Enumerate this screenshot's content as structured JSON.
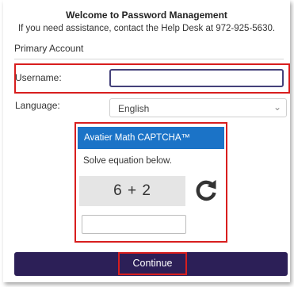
{
  "header": {
    "title": "Welcome to Password Management",
    "subtitle": "If you need assistance, contact the Help Desk at 972-925-5630."
  },
  "section": {
    "label": "Primary Account"
  },
  "form": {
    "username_label": "Username:",
    "username_value": "",
    "language_label": "Language:",
    "language_selected": "English"
  },
  "captcha": {
    "title": "Avatier Math CAPTCHA™",
    "instruction": "Solve equation below.",
    "equation": "6 + 2",
    "answer_value": "",
    "refresh_icon": "refresh-icon"
  },
  "actions": {
    "continue_label": "Continue"
  },
  "colors": {
    "highlight": "#d81e1e",
    "captcha_header": "#1b73c7",
    "continue_bar": "#2c1f57",
    "input_focus_border": "#44417a"
  }
}
